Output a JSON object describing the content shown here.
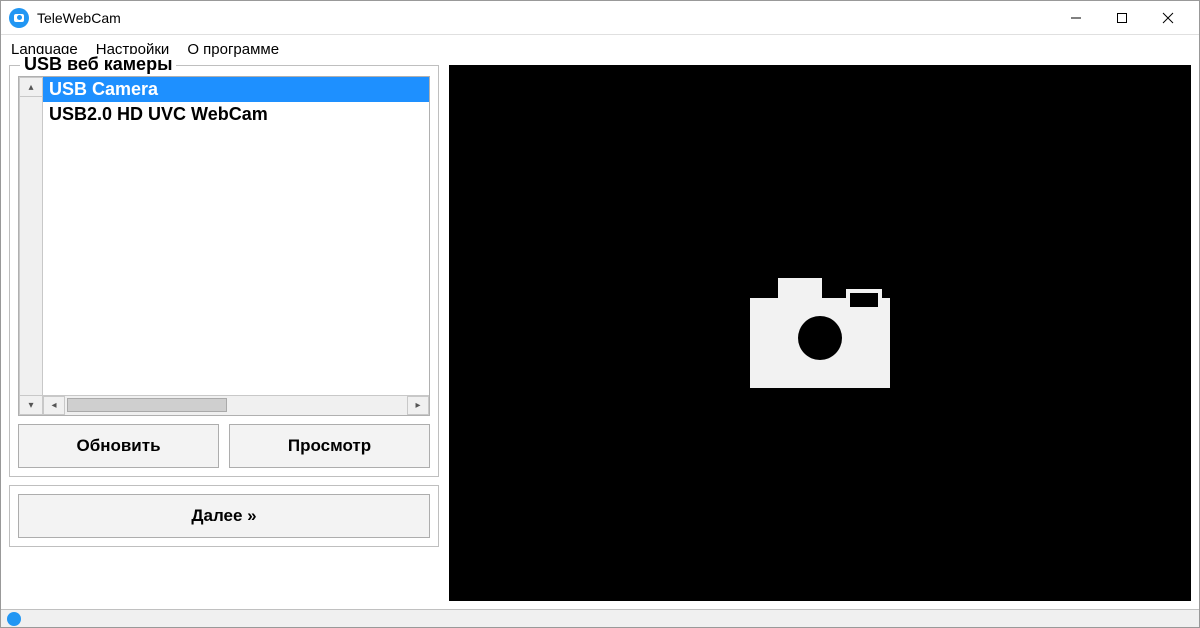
{
  "window": {
    "title": "TeleWebCam"
  },
  "menu": {
    "language": "Language",
    "settings": "Настройки",
    "about": "О программе"
  },
  "panel": {
    "title": "USB веб камеры",
    "cameras": [
      {
        "label": "USB Camera",
        "selected": true
      },
      {
        "label": "USB2.0 HD UVC WebCam",
        "selected": false
      }
    ]
  },
  "buttons": {
    "refresh": "Обновить",
    "preview": "Просмотр",
    "next": "Далее »"
  }
}
